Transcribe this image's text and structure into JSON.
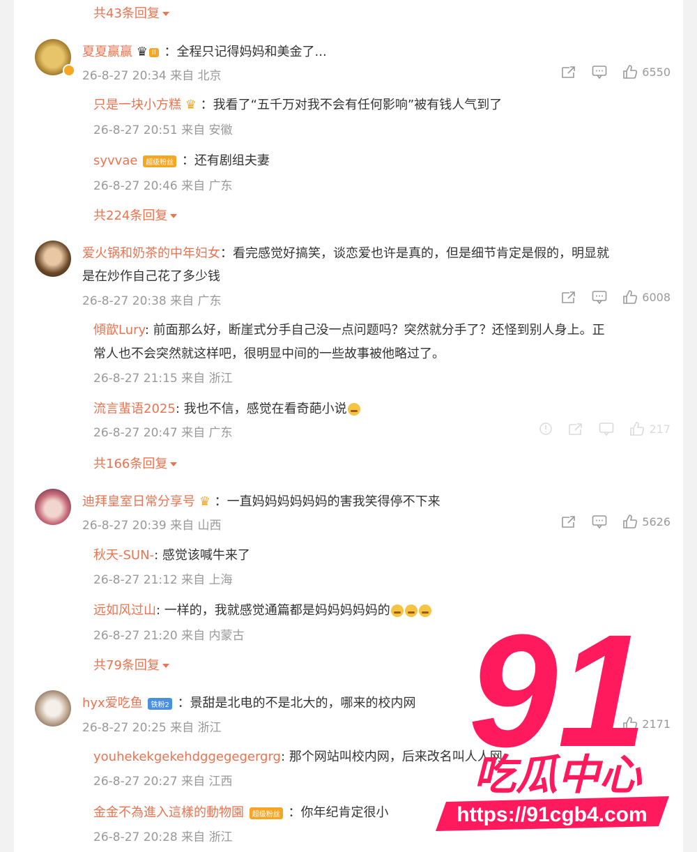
{
  "top_more": "共43条回复",
  "comments": [
    {
      "author": "夏夏赢赢",
      "author_badge": "II",
      "text": "：全程只记得妈妈和美金了...",
      "meta": "26-8-27 20:34 来自 北京",
      "likes": "6550",
      "replies": [
        {
          "author": "只是一块小方糕",
          "text": "：我看了“五千万对我不会有任何影响”被有钱人气到了",
          "meta": "26-8-27 20:51 来自 安徽"
        },
        {
          "author": "syvvae",
          "badge": "超级粉丝",
          "text": "：还有剧组夫妻",
          "meta": "26-8-27 20:46 来自 广东"
        }
      ],
      "more": "共224条回复"
    },
    {
      "author": "爱火锅和奶茶的中年妇女",
      "text_line1": "：看完感觉好搞笑，谈恋爱也许是真的，但是细节肯定是假的，明显就",
      "text_line2": "是在炒作自己花了多少钱",
      "meta": "26-8-27 20:38 来自 广东",
      "likes": "6008",
      "replies": [
        {
          "author": "傾歆Lury",
          "text_line1": ": 前面那么好，断崖式分手自己没一点问题吗？突然就分手了？还怪到别人身上。正",
          "text_line2": "常人也不会突然就这样吧，很明显中间的一些故事被他略过了。",
          "meta": "26-8-27 21:15 来自 浙江"
        },
        {
          "author": "流言蜚语2025",
          "text": ": 我也不信，感觉在看奇葩小说",
          "meta": "26-8-27 20:47 来自 广东",
          "likes": "217"
        }
      ],
      "more": "共166条回复"
    },
    {
      "author": "迪拜皇室日常分享号",
      "text": "：一直妈妈妈妈妈妈的害我笑得停不下来",
      "meta": "26-8-27 20:39 来自 山西",
      "likes": "5626",
      "replies": [
        {
          "author": "秋天-SUN-",
          "text": ": 感觉该喊牛来了",
          "meta": "26-8-27 21:12 来自 上海"
        },
        {
          "author": "远如风过山",
          "text": ": 一样的，我就感觉通篇都是妈妈妈妈妈的",
          "meta": "26-8-27 21:20 来自 内蒙古"
        }
      ],
      "more": "共79条回复"
    },
    {
      "author": "hyx爱吃鱼",
      "author_badge": "铁粉2",
      "text": "：景甜是北电的不是北大的，哪来的校内网",
      "meta": "26-8-27 20:25 来自 浙江",
      "likes": "2171",
      "replies": [
        {
          "author": "youhekekgekehdggegegergrg",
          "text": ": 那个网站叫校内网，后来改名叫人人网",
          "meta": "26-8-27 20:27 来自 江西"
        },
        {
          "author": "金金不為進入這樣的動物園",
          "badge": "超级粉丝",
          "text": "：你年纪肯定很小",
          "meta": "26-8-27 20:28 来自 浙江"
        }
      ]
    }
  ],
  "watermark": {
    "number": "91",
    "title": "吃瓜中心",
    "url": "https://91cgb4.com"
  },
  "colors": {
    "name": "#eb7350",
    "text": "#333333",
    "meta": "#999999",
    "watermark": "#ff1a5e"
  }
}
